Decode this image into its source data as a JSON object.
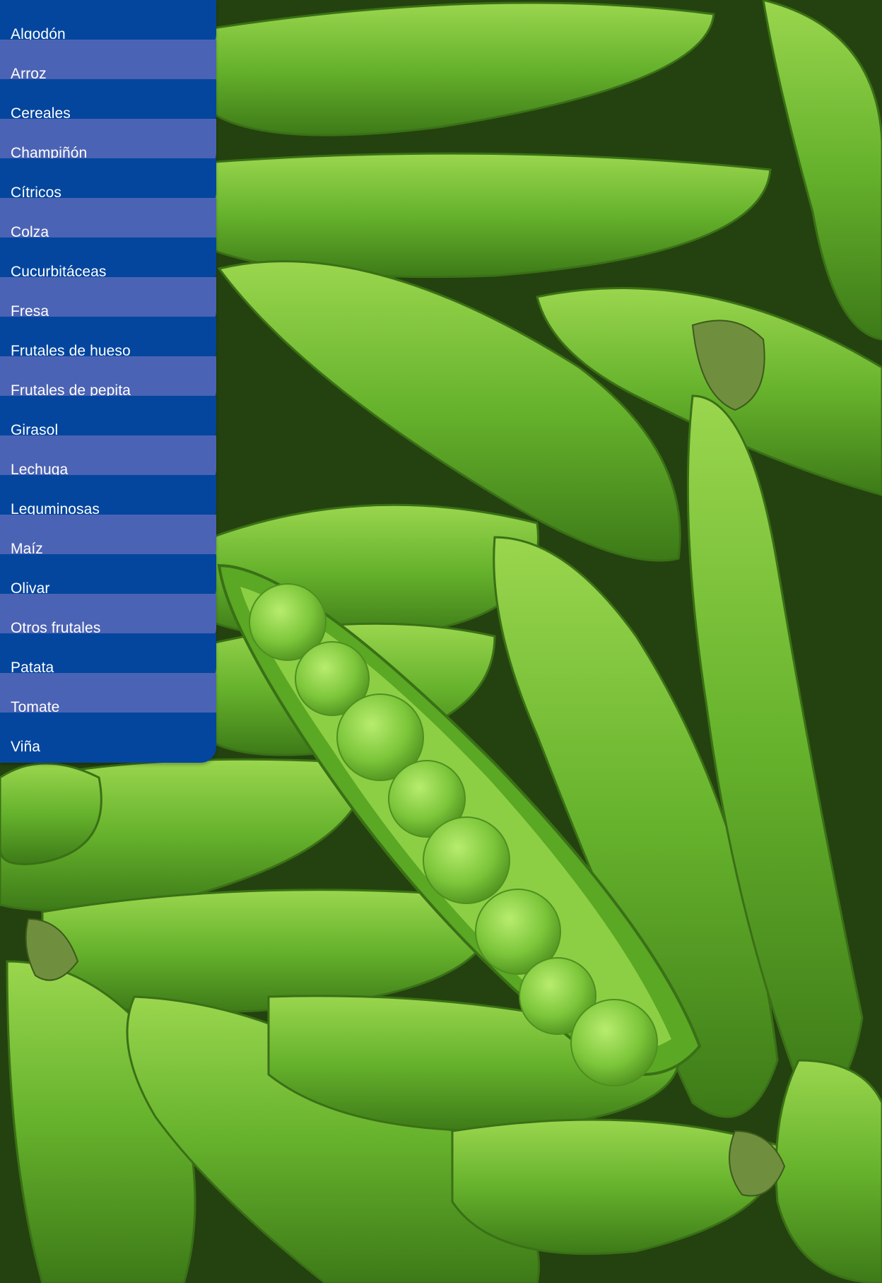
{
  "menu": {
    "items": [
      {
        "label": "Algodón",
        "color": "#04469e"
      },
      {
        "label": "Arroz",
        "color": "#4b63b4"
      },
      {
        "label": "Cereales",
        "color": "#04469e"
      },
      {
        "label": "Champiñón",
        "color": "#4b63b4"
      },
      {
        "label": "Cítricos",
        "color": "#04469e"
      },
      {
        "label": "Colza",
        "color": "#4b63b4"
      },
      {
        "label": "Cucurbitáceas",
        "color": "#04469e"
      },
      {
        "label": "Fresa",
        "color": "#4b63b4"
      },
      {
        "label": "Frutales de hueso",
        "color": "#04469e"
      },
      {
        "label": "Frutales de pepita",
        "color": "#4b63b4"
      },
      {
        "label": "Girasol",
        "color": "#04469e"
      },
      {
        "label": "Lechuga",
        "color": "#4b63b4"
      },
      {
        "label": "Leguminosas",
        "color": "#04469e"
      },
      {
        "label": "Maíz",
        "color": "#4b63b4"
      },
      {
        "label": "Olivar",
        "color": "#04469e"
      },
      {
        "label": "Otros frutales",
        "color": "#4b63b4"
      },
      {
        "label": "Patata",
        "color": "#04469e"
      },
      {
        "label": "Tomate",
        "color": "#4b63b4"
      },
      {
        "label": "Viña",
        "color": "#04469e"
      }
    ]
  },
  "background": {
    "subject": "pea-pods-photo",
    "colors": {
      "highlight": "#8fd048",
      "mid": "#5fae2a",
      "shadow": "#2c5512"
    }
  }
}
